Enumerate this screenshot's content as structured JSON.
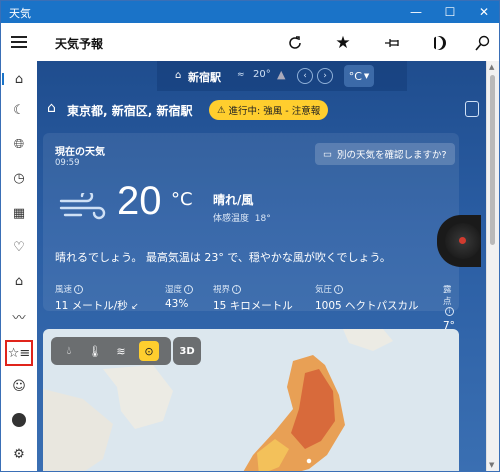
{
  "window": {
    "title": "天気",
    "minimize": "—",
    "maximize": "☐",
    "close": "✕"
  },
  "header": {
    "title": "天気予報",
    "icons": [
      "hamburger-icon",
      "refresh-icon",
      "star-icon",
      "pin-icon",
      "moon-icon",
      "search-icon"
    ]
  },
  "top_strip": {
    "station": "新宿駅",
    "temp": "20°",
    "unit_button": "°C"
  },
  "location": {
    "name": "東京都, 新宿区, 新宿駅",
    "alert": "進行中: 強風 - 注意報"
  },
  "current": {
    "title": "現在の天気",
    "time": "09:59",
    "other_weather_button": "別の天気を確認しますか?",
    "temperature": "20",
    "unit": "°C",
    "condition": "晴れ/風",
    "feels_like_label": "体感温度",
    "feels_like_value": "18°",
    "description": "晴れるでしょう。 最高気温は 23° で、穏やかな風が吹くでしょう。",
    "stats": [
      {
        "label": "風速",
        "value": "11 メートル/秒"
      },
      {
        "label": "湿度",
        "value": "43%"
      },
      {
        "label": "視界",
        "value": "15 キロメートル"
      },
      {
        "label": "気圧",
        "value": "1005 ヘクトパスカル"
      },
      {
        "label": "露点",
        "value": "7°"
      }
    ]
  },
  "map": {
    "tools": [
      "precipitation",
      "temperature",
      "wind",
      "clouds-selected"
    ],
    "button_3d": "3D"
  },
  "rail": {
    "items": [
      "home",
      "forecast",
      "maps",
      "history",
      "calendar",
      "favorites",
      "life",
      "trends",
      "favorites-list",
      "emoji",
      "user",
      "settings"
    ],
    "highlighted": "favorites-list"
  }
}
